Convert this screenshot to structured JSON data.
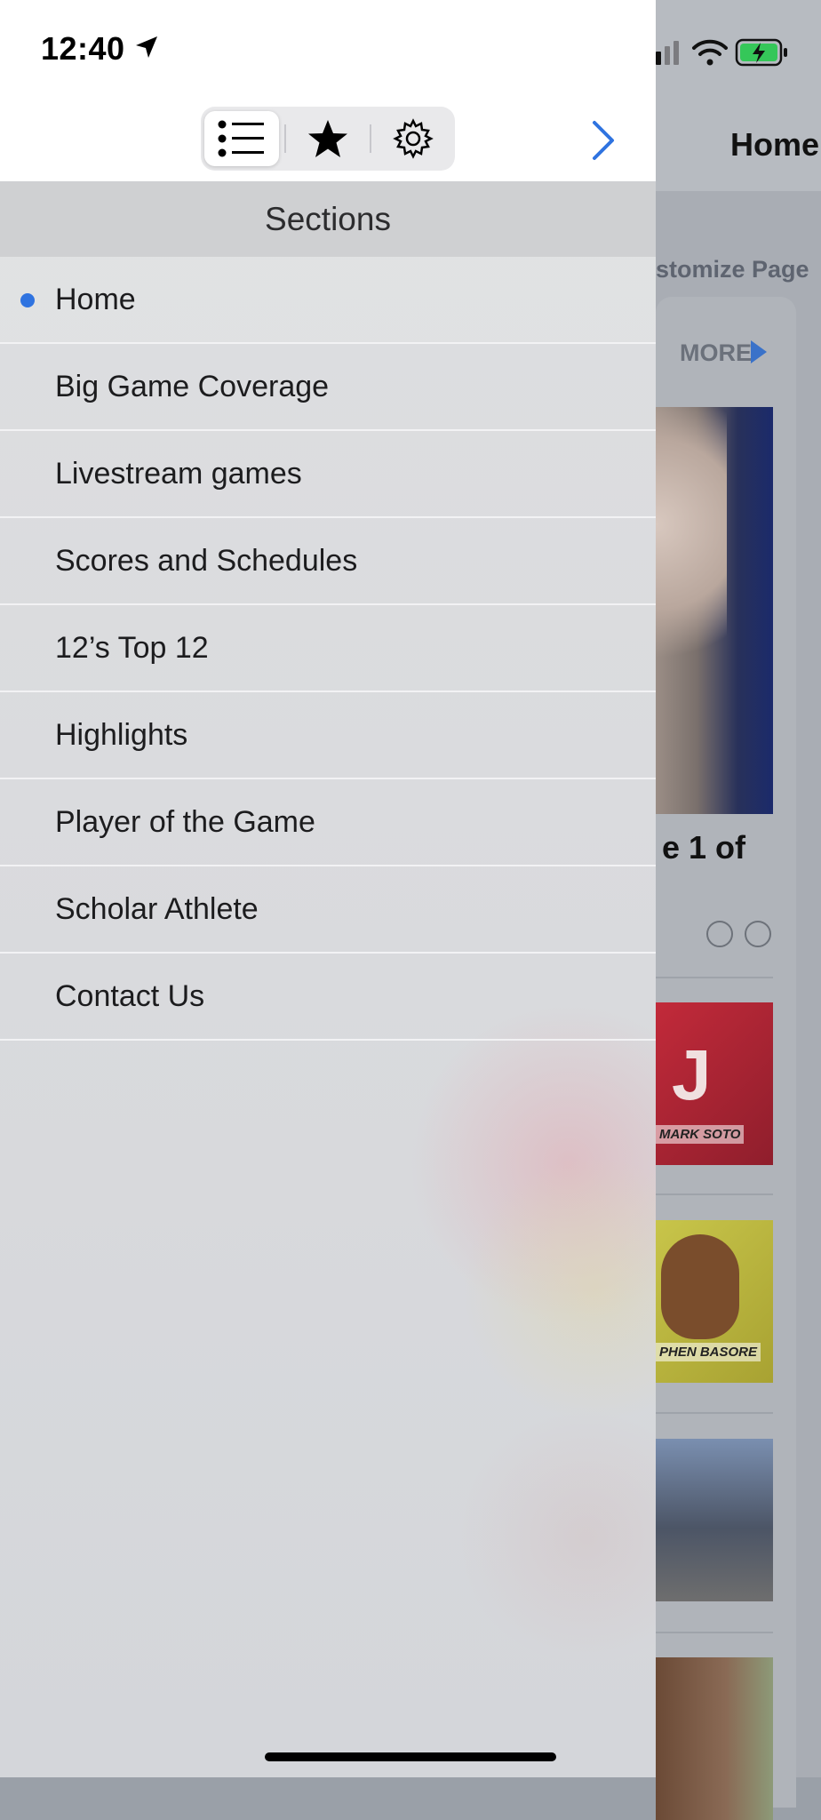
{
  "status_bar": {
    "time": "12:40",
    "battery_charging": true
  },
  "toolbar": {
    "segments": [
      {
        "name": "sections",
        "icon": "list-icon",
        "selected": true
      },
      {
        "name": "favorites",
        "icon": "star-icon",
        "selected": false
      },
      {
        "name": "settings",
        "icon": "gear-icon",
        "selected": false
      }
    ],
    "close_icon": "chevron-right-icon"
  },
  "sections": {
    "header": "Sections",
    "items": [
      {
        "label": "Home",
        "active": true
      },
      {
        "label": "Big Game Coverage",
        "active": false
      },
      {
        "label": "Livestream games",
        "active": false
      },
      {
        "label": "Scores and Schedules",
        "active": false
      },
      {
        "label": "12’s Top 12",
        "active": false
      },
      {
        "label": "Highlights",
        "active": false
      },
      {
        "label": "Player of the Game",
        "active": false
      },
      {
        "label": "Scholar Athlete",
        "active": false
      },
      {
        "label": "Contact Us",
        "active": false
      }
    ]
  },
  "background": {
    "title": "Home",
    "customize": "stomize Page",
    "more": "MORE",
    "caption": "e 1 of",
    "thumbs": [
      {
        "caption": "MARK SOTO"
      },
      {
        "caption": "PHEN BASORE"
      }
    ]
  },
  "colors": {
    "accent": "#2f73e0",
    "active_dot": "#2f73e0",
    "drawer_bg": "#dedfe1",
    "header_bg": "#cfd0d2"
  }
}
